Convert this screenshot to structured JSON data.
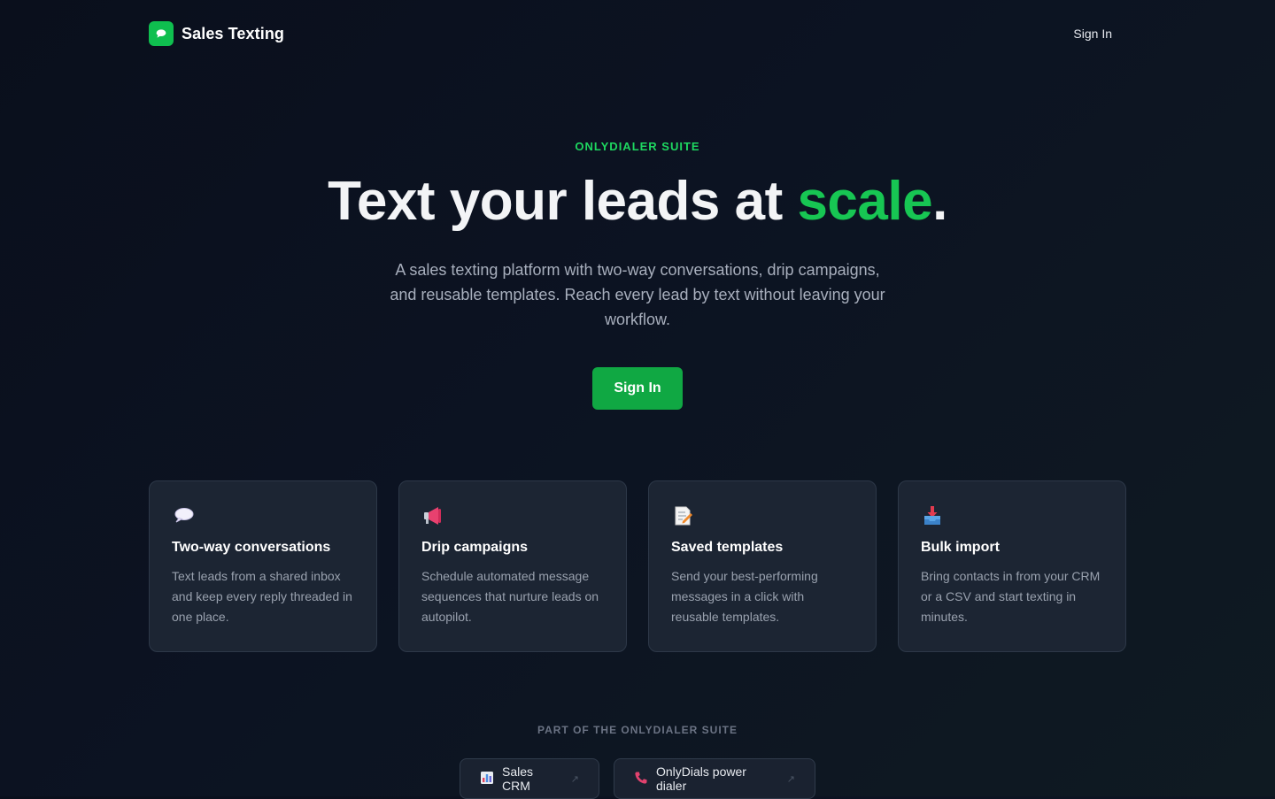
{
  "header": {
    "brand": "Sales Texting",
    "sign_in": "Sign In"
  },
  "hero": {
    "eyebrow": "ONLYDIALER SUITE",
    "headline_prefix": "Text your leads at ",
    "headline_accent": "scale",
    "headline_suffix": ".",
    "subtitle": "A sales texting platform with two-way conversations, drip campaigns, and reusable templates. Reach every lead by text without leaving your workflow.",
    "cta": "Sign In"
  },
  "features": [
    {
      "icon": "speech-bubble-icon",
      "title": "Two-way conversations",
      "description": "Text leads from a shared inbox and keep every reply threaded in one place."
    },
    {
      "icon": "megaphone-icon",
      "title": "Drip campaigns",
      "description": "Schedule automated message sequences that nurture leads on autopilot."
    },
    {
      "icon": "memo-icon",
      "title": "Saved templates",
      "description": "Send your best-performing messages in a click with reusable templates."
    },
    {
      "icon": "inbox-tray-icon",
      "title": "Bulk import",
      "description": "Bring contacts in from your CRM or a CSV and start texting in minutes."
    }
  ],
  "suite": {
    "label": "PART OF THE ONLYDIALER SUITE",
    "links": [
      {
        "icon": "bar-chart-icon",
        "label": "Sales CRM",
        "ext": "↗"
      },
      {
        "icon": "phone-icon",
        "label": "OnlyDials power dialer",
        "ext": "↗"
      }
    ]
  },
  "colors": {
    "accent": "#17c653",
    "button": "#10a843",
    "background": "#0c1322",
    "card": "#1c2533"
  }
}
